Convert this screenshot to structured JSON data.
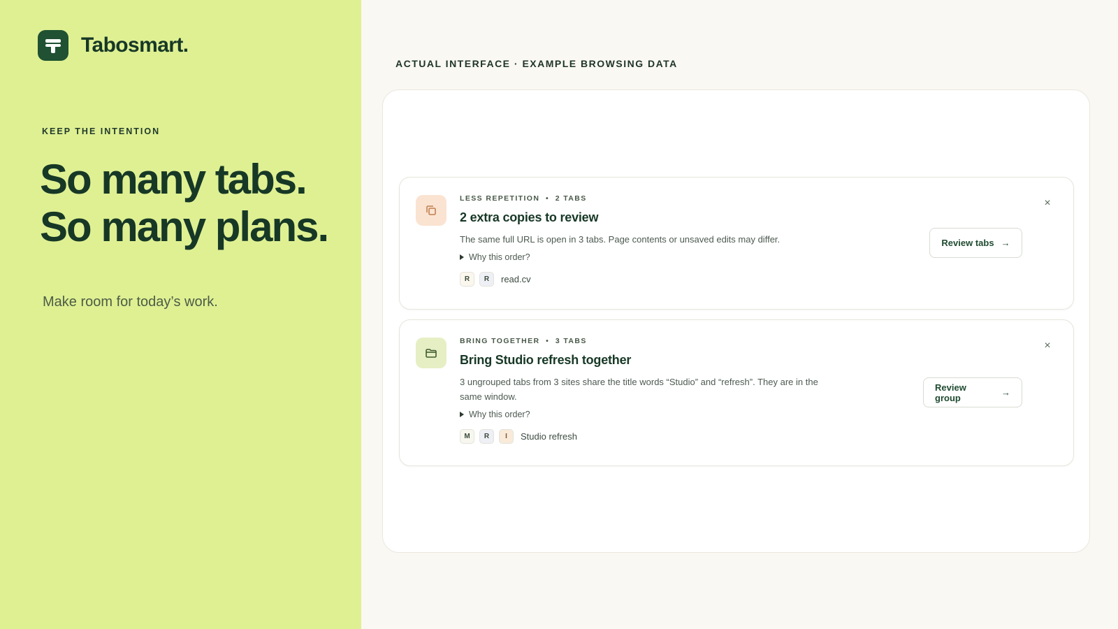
{
  "brand": {
    "name": "Tabosmart."
  },
  "hero": {
    "eyebrow": "KEEP THE INTENTION",
    "headline_line1": "So many tabs.",
    "headline_line2": "So many plans.",
    "tagline": "Make room for today’s work."
  },
  "preview": {
    "label": "ACTUAL INTERFACE · EXAMPLE BROWSING DATA"
  },
  "cards": [
    {
      "icon": "copy-icon",
      "kicker": "LESS REPETITION  •  2 TABS",
      "title": "2 extra copies to review",
      "description": "The same full URL is open in 3 tabs. Page contents or unsaved edits may differ.",
      "why": "Why this order?",
      "chips": [
        "R",
        "R"
      ],
      "chips_label": "read.cv",
      "button": "Review tabs",
      "button_arrow": "→",
      "close": "×"
    },
    {
      "icon": "folder-icon",
      "kicker": "BRING TOGETHER  •  3 TABS",
      "title": "Bring Studio refresh together",
      "description": "3 ungrouped tabs from 3 sites share the title words “Studio” and “refresh”. They are in the same window.",
      "why": "Why this order?",
      "chips": [
        "M",
        "R",
        "I"
      ],
      "chips_label": "Studio refresh",
      "button": "Review group",
      "button_arrow": "→",
      "close": "×"
    }
  ],
  "colors": {
    "left_panel": "#dff093",
    "brand_green": "#1f5132",
    "page_bg": "#faf8f2"
  }
}
